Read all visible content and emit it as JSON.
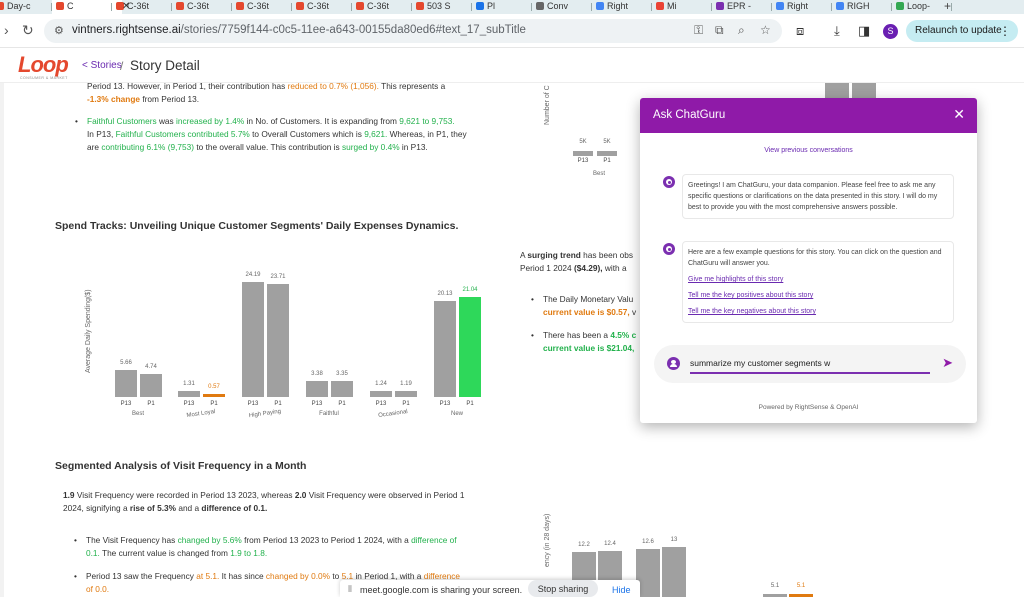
{
  "browser": {
    "tabs": [
      {
        "label": "Day-c",
        "color": "#e4482e"
      },
      {
        "label": "C",
        "color": "#e4482e"
      },
      {
        "label": "C-36t",
        "color": "#e4482e"
      },
      {
        "label": "C-36t",
        "color": "#e4482e"
      },
      {
        "label": "C-36t",
        "color": "#e4482e"
      },
      {
        "label": "C-36t",
        "color": "#e4482e"
      },
      {
        "label": "C-36t",
        "color": "#e4482e"
      },
      {
        "label": "503 S",
        "color": "#e4482e"
      },
      {
        "label": "Pl",
        "color": "#1a73e8"
      },
      {
        "label": "Conv",
        "color": "#666666"
      },
      {
        "label": "Right",
        "color": "#4285f4"
      },
      {
        "label": "Mi",
        "color": "#ea4335"
      },
      {
        "label": "EPR -",
        "color": "#7b2fb0"
      },
      {
        "label": "Right",
        "color": "#4285f4"
      },
      {
        "label": "RIGH",
        "color": "#4285f4"
      },
      {
        "label": "Loop-",
        "color": "#34a853"
      }
    ],
    "url_host": "vintners.rightsense.ai",
    "url_path": "/stories/7759f144-c0c5-11ee-a643-00155da80ed6#text_17_subTitle",
    "relaunch_label": "Relaunch to update",
    "profile_initial": "S"
  },
  "app": {
    "logo": "Loop",
    "logo_sub": "CONSUMER & MARKET",
    "breadcrumb_back": "< Stories",
    "breadcrumb_sep": "/",
    "page_title": "Story Detail"
  },
  "story": {
    "p1_line1": "Period 13. However, in Period 1, their contribution has",
    "p1_line1_o": "reduced to 0.7% (1,056).",
    "p1_line1_end": "This represents a",
    "p1_line2_o": "-1.3% change",
    "p1_line2_end": "from Period 13.",
    "faithful_a": "Faithful Customers",
    "faithful_b": "was",
    "faithful_c": "increased by 1.4%",
    "faithful_d": "in No. of Customers. It is expanding from",
    "faithful_e": "9,621 to 9,753.",
    "faithful2_a": "In P13,",
    "faithful2_b": "Faithful Customers contributed 5.7%",
    "faithful2_c": "to Overall Customers which is",
    "faithful2_d": "9,621.",
    "faithful2_e": "Whereas, in P1, they",
    "faithful3_a": "are",
    "faithful3_b": "contributing 6.1% (9,753)",
    "faithful3_c": "to the overall value. This contribution is",
    "faithful3_d": "surged by 0.4%",
    "faithful3_e": "in P13.",
    "spend_title": "Spend Tracks: Unveiling Unique Customer Segments' Daily Expenses Dynamics.",
    "right_text_a": "A",
    "right_text_b": "surging trend",
    "right_text_c": "has been obs",
    "right_text_d": "Period 1 2024",
    "right_text_e": "($4.29),",
    "right_text_f": "with a",
    "rb1_a": "The Daily Monetary Valu",
    "rb1_b": "current value is $0.57,",
    "rb1_c": "v",
    "rb2_a": "There has been a",
    "rb2_b": "4.5% c",
    "rb2_c": "current value is $21.04,",
    "visit_title": "Segmented Analysis of Visit Frequency in a Month",
    "visit_p_a": "1.9",
    "visit_p_b": "Visit Frequency were recorded in Period 13 2023, whereas",
    "visit_p_c": "2.0",
    "visit_p_d": "Visit Frequency were observed in Period 1",
    "visit_p2_a": "2024, signifying a",
    "visit_p2_b": "rise of 5.3%",
    "visit_p2_c": "and a",
    "visit_p2_d": "difference of 0.1.",
    "vb1_a": "The Visit Frequency has",
    "vb1_b": "changed by 5.6%",
    "vb1_c": "from Period 13 2023 to Period 1 2024, with a",
    "vb1_d": "difference of",
    "vb1_e": "0.1.",
    "vb1_f": "The current value is changed from",
    "vb1_g": "1.9 to 1.8.",
    "vb2_a": "Period 13 saw the Frequency",
    "vb2_b": "at 5.1.",
    "vb2_c": "It has since",
    "vb2_d": "changed by 0.0%",
    "vb2_e": "to",
    "vb2_f": "5.1",
    "vb2_g": "in Period 1, with a",
    "vb2_h": "difference",
    "vb2_i": "of 0.0."
  },
  "chart_data": [
    {
      "type": "bar",
      "title": "",
      "ylabel": "Average Daily Spending($)",
      "categories": [
        "Best",
        "Most Loyal",
        "High Paying",
        "Faithful",
        "Occasional",
        "New"
      ],
      "series": [
        {
          "name": "P13",
          "values": [
            5.66,
            1.31,
            24.19,
            3.38,
            1.24,
            20.13
          ]
        },
        {
          "name": "P1",
          "values": [
            4.74,
            0.57,
            23.71,
            3.35,
            1.19,
            21.04
          ]
        }
      ],
      "ylim": [
        0,
        26
      ],
      "highlight": {
        "down": "#e07a10",
        "up": "#2ed85a",
        "base": "#a0a0a0"
      }
    },
    {
      "type": "bar",
      "ylabel": "Number of C",
      "categories": [
        "Best"
      ],
      "series": [
        {
          "name": "P13",
          "values": [
            5
          ]
        },
        {
          "name": "P1",
          "values": [
            5
          ]
        }
      ],
      "value_labels": [
        "5K",
        "5K"
      ]
    },
    {
      "type": "bar",
      "ylabel": "ency (in 28 days)",
      "series_values": [
        12.2,
        12.4,
        12.6,
        13
      ],
      "extra_values": [
        5.1,
        5.1
      ]
    }
  ],
  "chat": {
    "title": "Ask ChatGuru",
    "view_previous": "View previous conversations",
    "greeting": "Greetings! I am ChatGuru, your data companion. Please feel free to ask me any specific questions or clarifications on the data presented in this story. I will do my best to provide you with the most comprehensive answers possible.",
    "examples_intro": "Here are a few example questions for this story. You can click on the question and ChatGuru will answer you.",
    "suggestions": [
      "Give me highlights of this story",
      "Tell me the key positives about this story",
      "Tell me the key negatives about this story"
    ],
    "input_value": "summarize my customer segments w",
    "powered_by": "Powered by RightSense & OpenAI"
  },
  "share": {
    "message": "meet.google.com is sharing your screen.",
    "stop_label": "Stop sharing",
    "hide_label": "Hide"
  }
}
